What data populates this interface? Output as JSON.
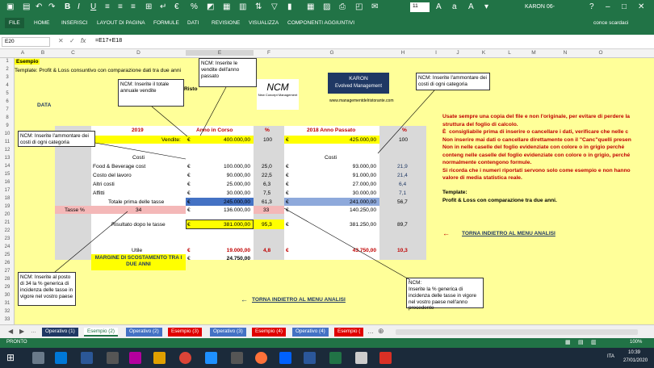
{
  "window": {
    "title": "KARON 06-",
    "user": "conce scardaci",
    "autosave_icon": "save-icon"
  },
  "ribbon": {
    "tabs": [
      "FILE",
      "HOME",
      "INSERISCI",
      "LAYOUT DI PAGINA",
      "FORMULE",
      "DATI",
      "REVISIONE",
      "VISUALIZZA",
      "COMPONENTI AGGIUNTIVI"
    ],
    "font_size": "11"
  },
  "formula_bar": {
    "name_box": "E20",
    "fx": "fx",
    "formula": "=E17+E18"
  },
  "columns": [
    "A",
    "B",
    "C",
    "D",
    "E",
    "F",
    "G",
    "H",
    "I",
    "J",
    "K",
    "L",
    "M",
    "N",
    "O"
  ],
  "rows": [
    "1",
    "2",
    "3",
    "4",
    "5",
    "6",
    "7",
    "8",
    "9",
    "10",
    "11",
    "12",
    "13",
    "14",
    "15",
    "16",
    "17",
    "18",
    "19",
    "20",
    "21",
    "22",
    "23",
    "24",
    "25",
    "26",
    "27",
    "28",
    "29",
    "30",
    "31",
    "32",
    "33"
  ],
  "sheet": {
    "esempio": "Esempio",
    "template": "Template: Profit & Loss consuntivo con comparazione dati tra due anni",
    "risto": "Risto",
    "data": "DATA",
    "hdr_2019": "2019",
    "hdr_anno": "Anno in Corso",
    "hdr_pct": "%",
    "hdr_2018": "2018 Anno Passato",
    "hdr_pct2": "%",
    "vendite_label": "Vendite:",
    "vendite_e": "400.000,00",
    "vendite_f": "100",
    "vendite_g": "425.000,00",
    "vendite_h": "100",
    "costi": "Costi",
    "costi2": "Costi",
    "items": [
      {
        "label": "Food & Beverage cost",
        "e": "100.000,00",
        "f": "25,0",
        "g": "93.000,00",
        "h": "21,9"
      },
      {
        "label": "Costo del lavoro",
        "e": "90.000,00",
        "f": "22,5",
        "g": "91.000,00",
        "h": "21,4"
      },
      {
        "label": "Altri costi",
        "e": "25.000,00",
        "f": "6,3",
        "g": "27.000,00",
        "h": "6,4"
      },
      {
        "label": "Affitti",
        "e": "30.000,00",
        "f": "7,5",
        "g": "30.000,00",
        "h": "7,1"
      }
    ],
    "totale_label": "Totale prima delle tasse",
    "totale_e": "245.000,00",
    "totale_f": "61,3",
    "totale_g": "241.000,00",
    "totale_h": "56,7",
    "tasse_label": "Tasse %",
    "tasse_d": "34",
    "tasse_e": "136.000,00",
    "tasse_f": "33",
    "tasse_g": "140.250,00",
    "risultato_label": "Risultato dopo le tasse",
    "risultato_e": "381.000,00",
    "risultato_f": "95,3",
    "risultato_g": "381.250,00",
    "risultato_h": "89,7",
    "utile_label": "Utile",
    "utile_e": "19.000,00",
    "utile_f": "4,8",
    "utile_g": "43.750,00",
    "utile_h": "10,3",
    "margine_label": "MARGINE DI SCOSTAMENTO TRA I DUE ANNI",
    "margine_e": "24.750,00",
    "euro": "€",
    "karon_title": "KARON",
    "karon_sub": "Evolved Management",
    "karon_url": "www.managementdelristorante.com",
    "logo_text": "NCM",
    "logo_sub": "New Concept Management",
    "torna1": "TORNA INDIETRO AL MENU ANALISI",
    "torna2": "TORNA INDIETRO AL MENU ANALISI",
    "arrow": "←",
    "notes_red": "Usate sempre una copia del file e non l'originale, per evitare di perdere la struttura del foglio di calcolo.\nÈ  consigliabile prima di inserire o cancellare i dati, verificare che nelle c Non inserire mai dati o cancellare direttamente con il \"Canc\"quelli presen Non in nelle caselle del foglio evidenziate con colore o in grigio perché conteng nelle caselle del foglio evidenziate con colore o in grigio, perché normalmente contengono formule.\nSi ricorda che i numeri riportati servono solo come esempio e non hanno valore di media statistica reale.",
    "template2": "Template:",
    "template2b": "Profit & Loss con comparazione tra due anni.",
    "comments": {
      "c1": "NCM: Inserite il totale annuale vendite",
      "c2": "NCM: Inserite le vendite dell'anno passato",
      "c3": "NCM: Inserite l'ammontare dei costi di ogni categoria",
      "c4": "NCM: Inserite l'ammontare dei costi di ogni categoria",
      "c5": "NCM: Inserite al posto di 34 la % generica di incidenza delle tasse in vigore nel vostro paese",
      "c6": "NCM:\nInserite la % generica di incidenza delle tasse in vigore nel vostro paese nell'anno precedente"
    }
  },
  "sheet_tabs": [
    {
      "label": "Operativo (1)",
      "color": "#1f3864"
    },
    {
      "label": "Esempio (2)",
      "color": "#ffffff"
    },
    {
      "label": "Operativo (2)",
      "color": "#4472c4"
    },
    {
      "label": "Esempio (3)",
      "color": "#e00000"
    },
    {
      "label": "Operativo (3)",
      "color": "#4472c4"
    },
    {
      "label": "Esempio (4)",
      "color": "#e00000"
    },
    {
      "label": "Operativo (4)",
      "color": "#4472c4"
    },
    {
      "label": "Esempio (",
      "color": "#e00000"
    }
  ],
  "status": {
    "left": "PRONTO",
    "zoom": "100%"
  },
  "taskbar": {
    "time": "10:39",
    "date": "27/01/2020",
    "lang": "ITA"
  }
}
